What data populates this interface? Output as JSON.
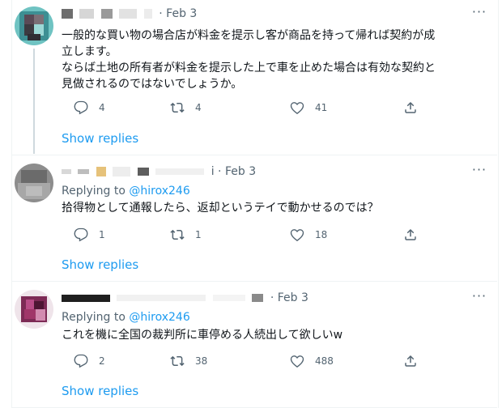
{
  "colors": {
    "accent": "#1d9bf0",
    "muted": "#536471",
    "text": "#0f1419",
    "divider": "#eff3f4"
  },
  "tweets": [
    {
      "time": "· Feb 3",
      "replying_label": "",
      "handle": "",
      "text_lines": [
        "一般的な買い物の場合店が料金を提示し客が商品を持って帰れば契約が成",
        "立します。",
        "ならば土地の所有者が料金を提示した上で車を止めた場合は有効な契約と",
        "見做されるのではないでしょうか。"
      ],
      "replies": "4",
      "retweets": "4",
      "likes": "41",
      "show_replies": "Show replies"
    },
    {
      "time": "i · Feb 3",
      "replying_label": "Replying to",
      "handle": "@hirox246",
      "text_lines": [
        "拾得物として通報したら、返却というテイで動かせるのでは？"
      ],
      "replies": "1",
      "retweets": "1",
      "likes": "18",
      "show_replies": "Show replies"
    },
    {
      "time": "· Feb 3",
      "replying_label": "Replying to",
      "handle": "@hirox246",
      "text_lines": [
        "これを機に全国の裁判所に車停める人続出して欲しいw"
      ],
      "replies": "2",
      "retweets": "38",
      "likes": "488",
      "show_replies": "Show replies"
    }
  ],
  "icons": {
    "more": "more-dots-icon",
    "reply": "reply-icon",
    "retweet": "retweet-icon",
    "like": "heart-icon",
    "share": "share-icon"
  }
}
